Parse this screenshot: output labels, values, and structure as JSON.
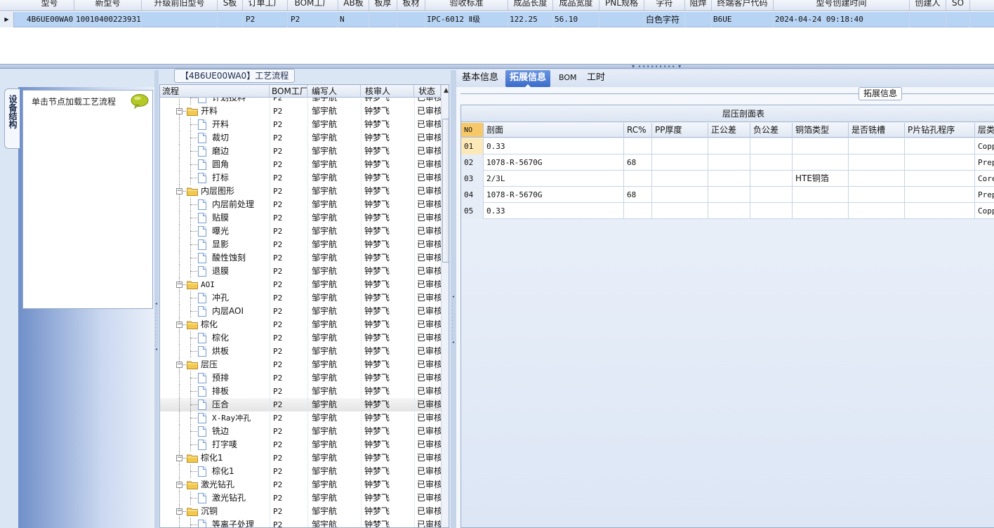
{
  "top_grid": {
    "headers": [
      "型号",
      "新型号",
      "升级前旧型号",
      "S板",
      "订单工厂",
      "BOM工厂",
      "AB板",
      "板厚",
      "板材",
      "验收标准",
      "成品长度",
      "成品宽度",
      "PNL规格",
      "字符",
      "阻焊",
      "终端客户代码",
      "型号创建时间",
      "创建人",
      "SO"
    ],
    "row": {
      "indicator": "▶",
      "model": "4B6UE00WA0",
      "new_model": "10010400223931",
      "old_model": "",
      "s_board": "",
      "order_factory": "P2",
      "bom_factory": "P2",
      "ab_board": "N",
      "thickness": "",
      "material": "",
      "acceptance": "IPC-6012 Ⅱ级",
      "length": "122.25",
      "width": "56.10",
      "pnl": "",
      "char": "白色字符",
      "mask": "",
      "customer_code": "B6UE",
      "created_time": "2024-04-24 09:18:40",
      "creator": "",
      "so": ""
    }
  },
  "left_panel": {
    "title": "【4B6UE00WA0】工艺流程",
    "vertical_tab": "设备结构",
    "nav_hint": "单击节点加载工艺流程"
  },
  "tree_grid": {
    "headers": [
      "流程",
      "BOM工厂",
      "编写人",
      "核审人",
      "状态"
    ],
    "rows": [
      {
        "name": "计划投料",
        "level": 2,
        "type": "doc",
        "factory": "P2",
        "writer": "邹宇航",
        "reviewer": "钟梦飞",
        "status": "已审核"
      },
      {
        "name": "开料",
        "level": 1,
        "type": "folder",
        "factory": "P2",
        "writer": "邹宇航",
        "reviewer": "钟梦飞",
        "status": "已审核"
      },
      {
        "name": "开料",
        "level": 2,
        "type": "doc",
        "factory": "P2",
        "writer": "邹宇航",
        "reviewer": "钟梦飞",
        "status": "已审核"
      },
      {
        "name": "裁切",
        "level": 2,
        "type": "doc",
        "factory": "P2",
        "writer": "邹宇航",
        "reviewer": "钟梦飞",
        "status": "已审核"
      },
      {
        "name": "磨边",
        "level": 2,
        "type": "doc",
        "factory": "P2",
        "writer": "邹宇航",
        "reviewer": "钟梦飞",
        "status": "已审核"
      },
      {
        "name": "圆角",
        "level": 2,
        "type": "doc",
        "factory": "P2",
        "writer": "邹宇航",
        "reviewer": "钟梦飞",
        "status": "已审核"
      },
      {
        "name": "打标",
        "level": 2,
        "type": "doc",
        "factory": "P2",
        "writer": "邹宇航",
        "reviewer": "钟梦飞",
        "status": "已审核"
      },
      {
        "name": "内层图形",
        "level": 1,
        "type": "folder",
        "factory": "P2",
        "writer": "邹宇航",
        "reviewer": "钟梦飞",
        "status": "已审核"
      },
      {
        "name": "内层前处理",
        "level": 2,
        "type": "doc",
        "factory": "P2",
        "writer": "邹宇航",
        "reviewer": "钟梦飞",
        "status": "已审核"
      },
      {
        "name": "贴膜",
        "level": 2,
        "type": "doc",
        "factory": "P2",
        "writer": "邹宇航",
        "reviewer": "钟梦飞",
        "status": "已审核"
      },
      {
        "name": "曝光",
        "level": 2,
        "type": "doc",
        "factory": "P2",
        "writer": "邹宇航",
        "reviewer": "钟梦飞",
        "status": "已审核"
      },
      {
        "name": "显影",
        "level": 2,
        "type": "doc",
        "factory": "P2",
        "writer": "邹宇航",
        "reviewer": "钟梦飞",
        "status": "已审核"
      },
      {
        "name": "酸性蚀刻",
        "level": 2,
        "type": "doc",
        "factory": "P2",
        "writer": "邹宇航",
        "reviewer": "钟梦飞",
        "status": "已审核"
      },
      {
        "name": "退膜",
        "level": 2,
        "type": "doc",
        "factory": "P2",
        "writer": "邹宇航",
        "reviewer": "钟梦飞",
        "status": "已审核"
      },
      {
        "name": "AOI",
        "level": 1,
        "type": "folder",
        "factory": "P2",
        "writer": "邹宇航",
        "reviewer": "钟梦飞",
        "status": "已审核"
      },
      {
        "name": "冲孔",
        "level": 2,
        "type": "doc",
        "factory": "P2",
        "writer": "邹宇航",
        "reviewer": "钟梦飞",
        "status": "已审核"
      },
      {
        "name": "内层AOI",
        "level": 2,
        "type": "doc",
        "factory": "P2",
        "writer": "邹宇航",
        "reviewer": "钟梦飞",
        "status": "已审核"
      },
      {
        "name": "棕化",
        "level": 1,
        "type": "folder",
        "factory": "P2",
        "writer": "邹宇航",
        "reviewer": "钟梦飞",
        "status": "已审核"
      },
      {
        "name": "棕化",
        "level": 2,
        "type": "doc",
        "factory": "P2",
        "writer": "邹宇航",
        "reviewer": "钟梦飞",
        "status": "已审核"
      },
      {
        "name": "烘板",
        "level": 2,
        "type": "doc",
        "factory": "P2",
        "writer": "邹宇航",
        "reviewer": "钟梦飞",
        "status": "已审核"
      },
      {
        "name": "层压",
        "level": 1,
        "type": "folder",
        "factory": "P2",
        "writer": "邹宇航",
        "reviewer": "钟梦飞",
        "status": "已审核"
      },
      {
        "name": "预排",
        "level": 2,
        "type": "doc",
        "factory": "P2",
        "writer": "邹宇航",
        "reviewer": "钟梦飞",
        "status": "已审核"
      },
      {
        "name": "排板",
        "level": 2,
        "type": "doc",
        "factory": "P2",
        "writer": "邹宇航",
        "reviewer": "钟梦飞",
        "status": "已审核"
      },
      {
        "name": "压合",
        "level": 2,
        "type": "doc",
        "factory": "P2",
        "writer": "邹宇航",
        "reviewer": "钟梦飞",
        "status": "已审核",
        "selected": true
      },
      {
        "name": "X-Ray冲孔",
        "level": 2,
        "type": "doc",
        "factory": "P2",
        "writer": "邹宇航",
        "reviewer": "钟梦飞",
        "status": "已审核"
      },
      {
        "name": "铣边",
        "level": 2,
        "type": "doc",
        "factory": "P2",
        "writer": "邹宇航",
        "reviewer": "钟梦飞",
        "status": "已审核"
      },
      {
        "name": "打字唛",
        "level": 2,
        "type": "doc",
        "factory": "P2",
        "writer": "邹宇航",
        "reviewer": "钟梦飞",
        "status": "已审核"
      },
      {
        "name": "棕化1",
        "level": 1,
        "type": "folder",
        "factory": "P2",
        "writer": "邹宇航",
        "reviewer": "钟梦飞",
        "status": "已审核"
      },
      {
        "name": "棕化1",
        "level": 2,
        "type": "doc",
        "factory": "P2",
        "writer": "邹宇航",
        "reviewer": "钟梦飞",
        "status": "已审核"
      },
      {
        "name": "激光钻孔",
        "level": 1,
        "type": "folder",
        "factory": "P2",
        "writer": "邹宇航",
        "reviewer": "钟梦飞",
        "status": "已审核"
      },
      {
        "name": "激光钻孔",
        "level": 2,
        "type": "doc",
        "factory": "P2",
        "writer": "邹宇航",
        "reviewer": "钟梦飞",
        "status": "已审核"
      },
      {
        "name": "沉铜",
        "level": 1,
        "type": "folder",
        "factory": "P2",
        "writer": "邹宇航",
        "reviewer": "钟梦飞",
        "status": "已审核"
      },
      {
        "name": "等离子处理",
        "level": 2,
        "type": "doc",
        "factory": "P2",
        "writer": "邹宇航",
        "reviewer": "钟梦飞",
        "status": "已审核"
      }
    ]
  },
  "right_panel": {
    "tabs": [
      "基本信息",
      "拓展信息",
      "BOM",
      "工时"
    ],
    "active_tab": "拓展信息",
    "group_title": "拓展信息",
    "table_title": "层压剖面表",
    "columns": [
      "NO",
      "剖面",
      "RC%",
      "PP厚度",
      "正公差",
      "负公差",
      "铜箔类型",
      "是否铣槽",
      "P片钻孔程序",
      "层类"
    ],
    "rows": [
      [
        "01",
        "0.33",
        "",
        "",
        "",
        "",
        "",
        "",
        "",
        "Copp"
      ],
      [
        "02",
        "1078-R-5670G",
        "68",
        "",
        "",
        "",
        "",
        "",
        "",
        "Prep"
      ],
      [
        "03",
        "2/3L",
        "",
        "",
        "",
        "",
        "HTE铜箔",
        "",
        "",
        "Core"
      ],
      [
        "04",
        "1078-R-5670G",
        "68",
        "",
        "",
        "",
        "",
        "",
        "",
        "Prep"
      ],
      [
        "05",
        "0.33",
        "",
        "",
        "",
        "",
        "",
        "",
        "",
        "Copp"
      ]
    ]
  },
  "colors": {
    "selection": "#b8d4f4",
    "active_tab": "#3b6cc9",
    "no_header": "#f6c86a",
    "folder": "#f2c94c"
  },
  "icons": {
    "chat": "chat-bubble-icon",
    "folder": "folder-icon",
    "document": "document-icon"
  }
}
